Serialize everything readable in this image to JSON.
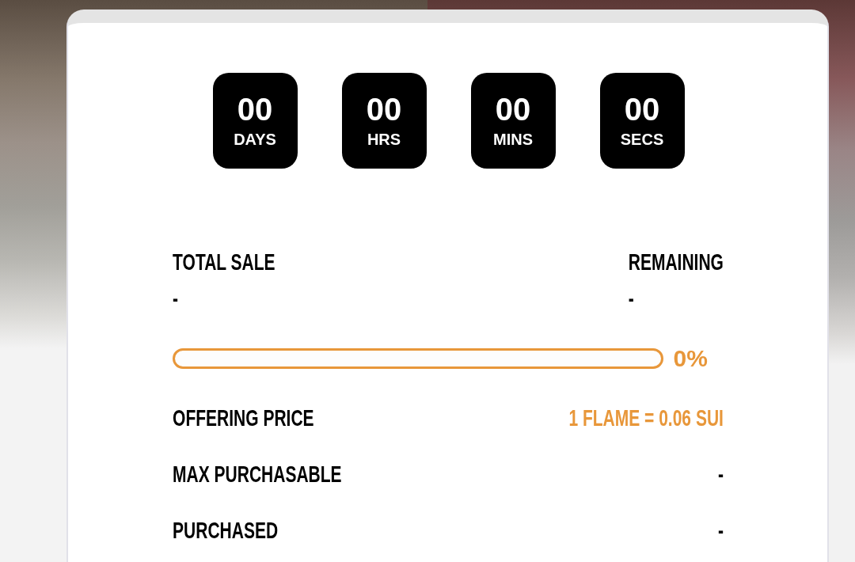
{
  "countdown": [
    {
      "value": "00",
      "unit": "DAYS"
    },
    {
      "value": "00",
      "unit": "HRS"
    },
    {
      "value": "00",
      "unit": "MINS"
    },
    {
      "value": "00",
      "unit": "SECS"
    }
  ],
  "totals": [
    {
      "label": "TOTAL SALE",
      "value": "-"
    },
    {
      "label": "REMAINING",
      "value": "-"
    }
  ],
  "progress": {
    "level": 0,
    "reading": "0%"
  },
  "details": [
    {
      "label": "OFFERING PRICE",
      "value": "1 FLAME = 0.06 SUI",
      "highlight": true
    },
    {
      "label": "MAX PURCHASABLE",
      "value": "-",
      "highlight": false
    },
    {
      "label": "PURCHASED",
      "value": "-",
      "highlight": false
    }
  ]
}
